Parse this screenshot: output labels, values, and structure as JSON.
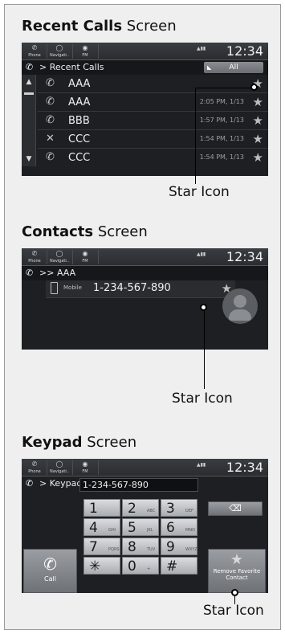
{
  "recent": {
    "title_bold": "Recent Calls",
    "title_rest": " Screen",
    "status": {
      "phone": "Phone",
      "navi": "Navigati..",
      "fm": "FM",
      "clock": "12:34"
    },
    "crumb": "Recent Calls",
    "filter": "All",
    "rows": [
      {
        "name": "AAA",
        "time": ""
      },
      {
        "name": "AAA",
        "time": "2:05 PM, 1/13"
      },
      {
        "name": "BBB",
        "time": "1:57 PM, 1/13"
      },
      {
        "name": "CCC",
        "time": "1:54 PM, 1/13"
      },
      {
        "name": "CCC",
        "time": "1:54 PM, 1/13"
      }
    ],
    "callout": "Star Icon"
  },
  "contacts": {
    "title_bold": "Contacts",
    "title_rest": " Screen",
    "status": {
      "phone": "Phone",
      "navi": "Navigati..",
      "fm": "FM",
      "clock": "12:34"
    },
    "crumb": "AAA",
    "label": "Mobile",
    "number": "1-234-567-890",
    "callout": "Star Icon"
  },
  "keypad": {
    "title_bold": "Keypad",
    "title_rest": " Screen",
    "status": {
      "phone": "Phone",
      "navi": "Navigati..",
      "fm": "FM",
      "clock": "12:34"
    },
    "crumb": "Keypad",
    "number": "1-234-567-890",
    "keys": [
      {
        "num": "1",
        "sub": ""
      },
      {
        "num": "2",
        "sub": "ABC"
      },
      {
        "num": "3",
        "sub": "DEF"
      },
      {
        "num": "4",
        "sub": "GHI"
      },
      {
        "num": "5",
        "sub": "JKL"
      },
      {
        "num": "6",
        "sub": "MNO"
      },
      {
        "num": "7",
        "sub": "PQRS"
      },
      {
        "num": "8",
        "sub": "TUV"
      },
      {
        "num": "9",
        "sub": "WXYZ"
      },
      {
        "num": "✳",
        "sub": ""
      },
      {
        "num": "0",
        "sub": "+"
      },
      {
        "num": "#",
        "sub": ""
      }
    ],
    "call_label": "Call",
    "remove_fav_label": "Remove Favorite Contact",
    "callout": "Star Icon"
  }
}
